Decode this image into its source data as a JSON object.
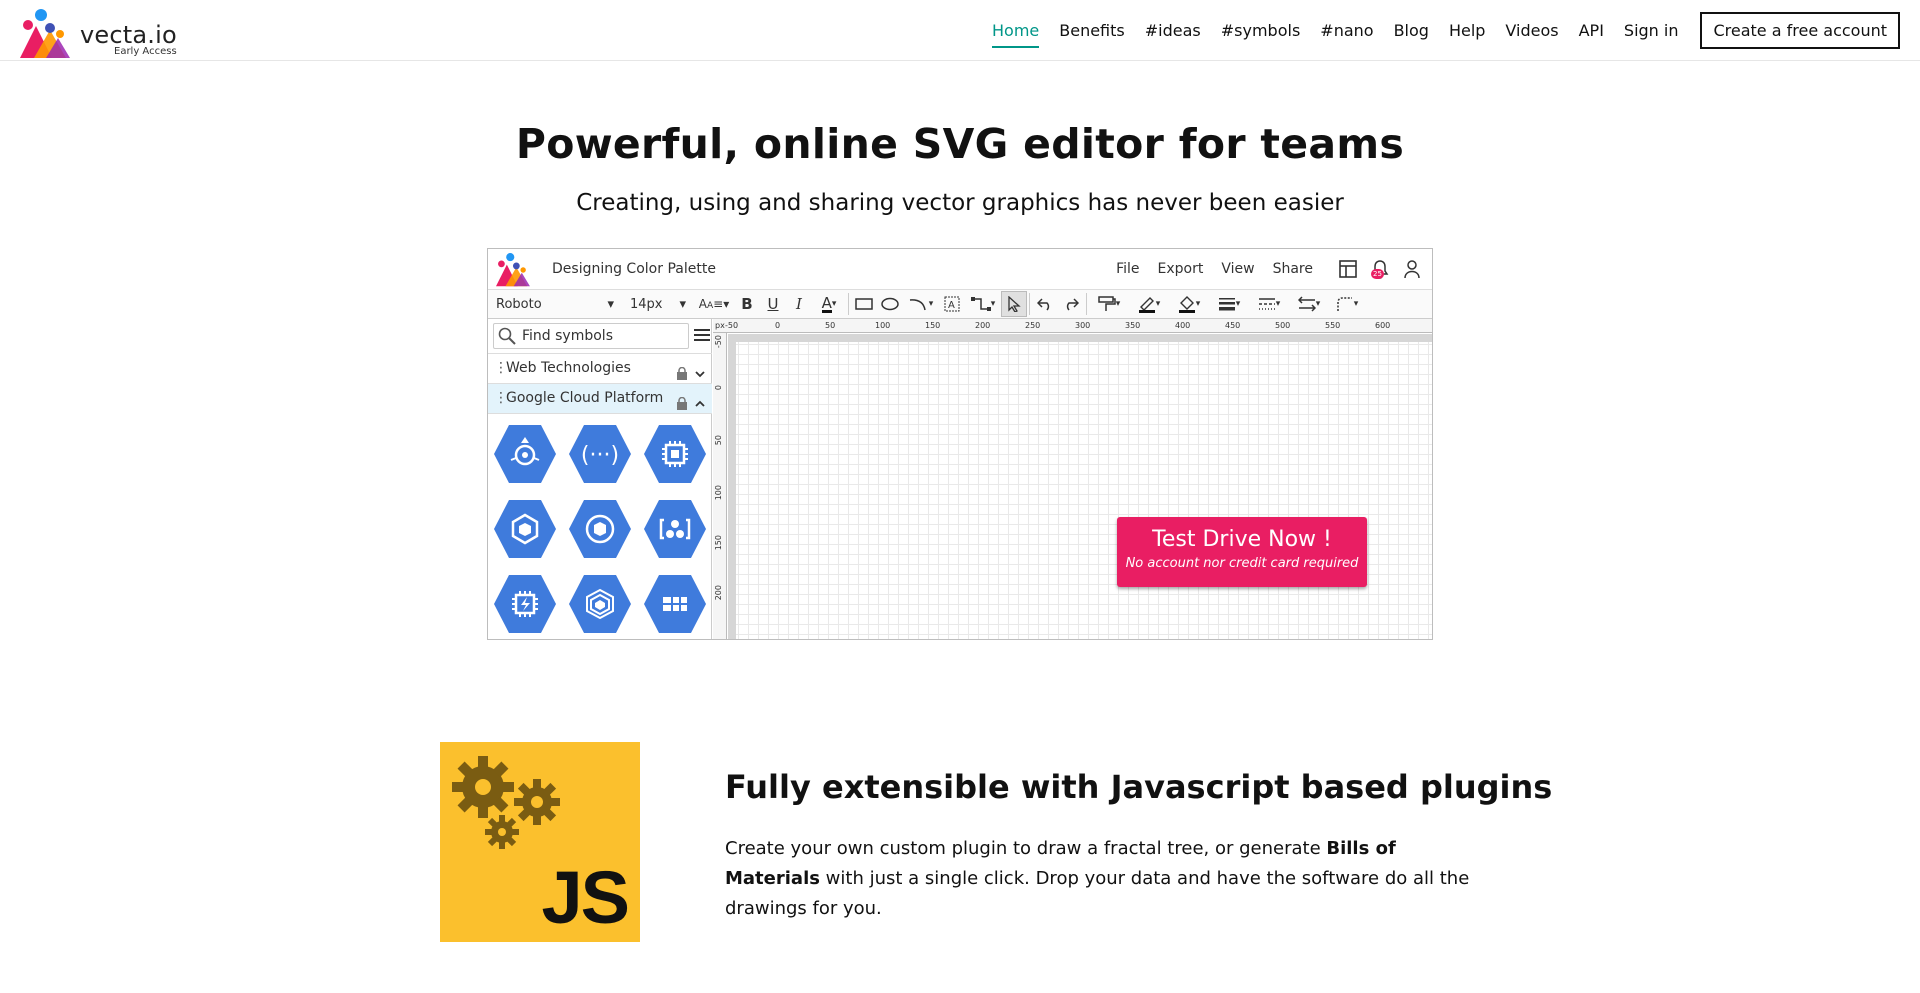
{
  "brand": {
    "name": "vecta.io",
    "tag": "Early Access"
  },
  "nav": {
    "items": [
      "Home",
      "Benefits",
      "#ideas",
      "#symbols",
      "#nano",
      "Blog",
      "Help",
      "Videos",
      "API",
      "Sign in"
    ],
    "cta": "Create a free account",
    "active": "Home"
  },
  "hero": {
    "title": "Powerful, online SVG editor for teams",
    "subtitle": "Creating, using and sharing vector graphics has never been easier"
  },
  "app": {
    "doc_title": "Designing Color Palette",
    "menu": [
      "File",
      "Export",
      "View",
      "Share"
    ],
    "notif_count": "25",
    "toolbar": {
      "font": "Roboto",
      "size": "14px"
    },
    "search_placeholder": "Find symbols",
    "groups": [
      "Web Technologies",
      "Google Cloud Platform"
    ],
    "ruler": {
      "unit": "px",
      "top_ticks": [
        "-50",
        "0",
        "50",
        "100",
        "150",
        "200",
        "250",
        "300",
        "350",
        "400",
        "450",
        "500",
        "550",
        "600"
      ],
      "left_ticks": [
        "-50",
        "0",
        "50",
        "100",
        "150",
        "200"
      ]
    },
    "test_drive": {
      "title": "Test Drive Now !",
      "sub": "No account nor credit card required"
    },
    "symbol_icons": [
      "endpoints-icon",
      "api-icon",
      "compute-engine-icon",
      "container-engine-icon",
      "container-registry-icon",
      "cluster-icon",
      "cloud-tpu-icon",
      "layers-icon",
      "apps-grid-icon"
    ]
  },
  "feature": {
    "title": "Fully extensible with Javascript based plugins",
    "text_1": "Create your own custom plugin to draw a fractal tree, or generate ",
    "text_bold": "Bills of Materials",
    "text_2": " with just a single click. Drop your data and have the software do all the drawings for you.",
    "image_label": "JS"
  },
  "colors": {
    "accent": "#009688",
    "cta_pink": "#e91e63",
    "js_yellow": "#fbc02d",
    "hex_blue": "#3f7bdc"
  }
}
